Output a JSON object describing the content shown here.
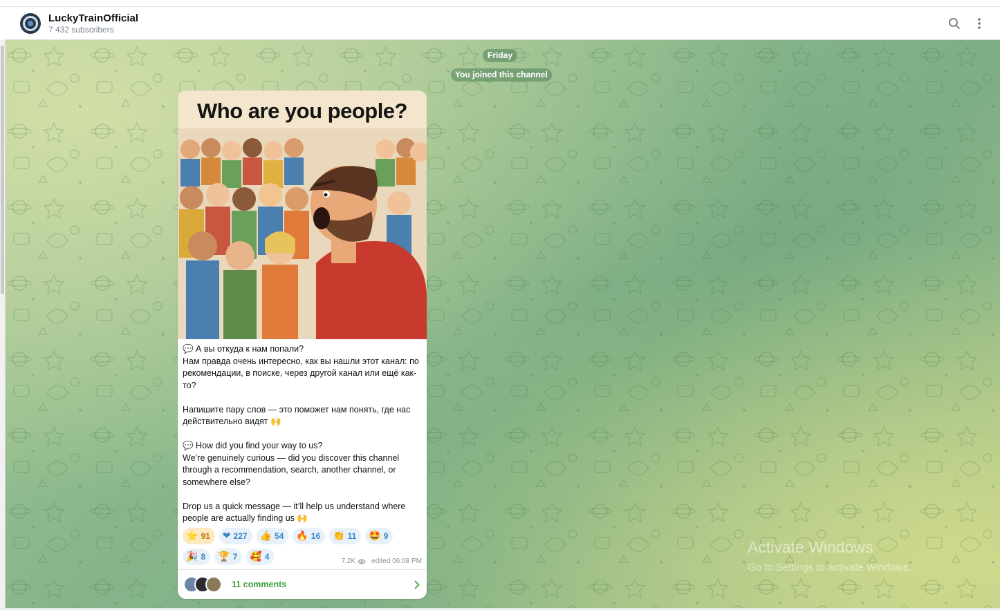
{
  "header": {
    "title": "LuckyTrainOfficial",
    "subtitle": "7 432 subscribers",
    "search_icon": "search-icon",
    "menu_icon": "more-vertical-icon"
  },
  "chat": {
    "date_label": "Friday",
    "service_message": "You joined this channel"
  },
  "post": {
    "image_title": "Who are you people?",
    "text": "💬 А вы откуда к нам попали?\nНам правда очень интересно, как вы нашли этот канал: по рекомендации, в поиске, через другой канал или ещё как-то?\n\nНапишите пару слов — это поможет нам понять, где нас действительно видят 🙌\n\n💬 How did you find your way to us?\nWe’re genuinely curious — did you discover this channel through a recommendation, search, another channel, or somewhere else?\n\nDrop us a quick message — it’ll help us understand where people are actually finding us 🙌",
    "reactions": [
      {
        "emoji": "⭐",
        "count": "91"
      },
      {
        "emoji": "❤",
        "count": "227"
      },
      {
        "emoji": "👍",
        "count": "54"
      },
      {
        "emoji": "🔥",
        "count": "16"
      },
      {
        "emoji": "👏",
        "count": "11"
      },
      {
        "emoji": "🤩",
        "count": "9"
      },
      {
        "emoji": "🎉",
        "count": "8"
      },
      {
        "emoji": "🏆",
        "count": "7"
      },
      {
        "emoji": "🥰",
        "count": "4"
      }
    ],
    "views": "7.2K",
    "edited": "edited 06:08 PM",
    "comments_label": "11 comments"
  },
  "watermark": {
    "line1": "Activate Windows",
    "line2": "Go to Settings to activate Windows."
  },
  "colors": {
    "accent_green": "#3da33d",
    "reaction_blue": "#3b86c6",
    "chosen_reaction_bg": "#fde9c2"
  }
}
